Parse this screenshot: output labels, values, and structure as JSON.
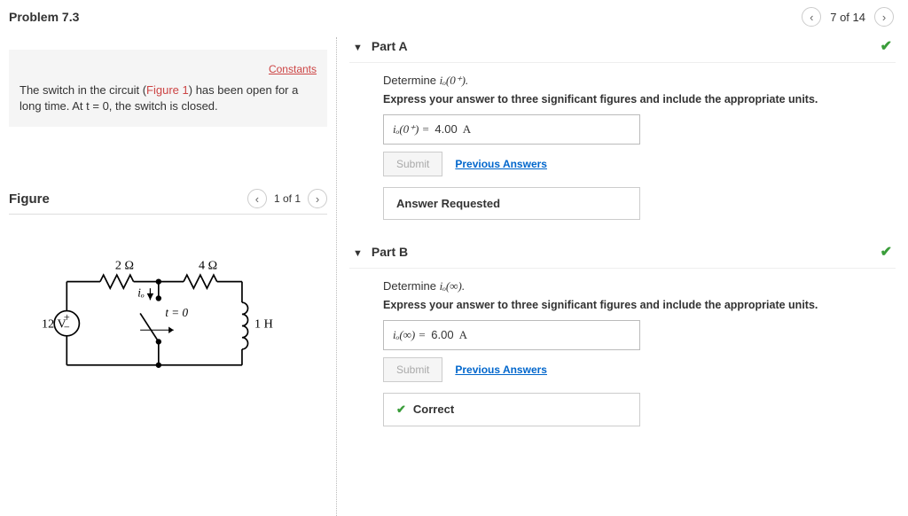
{
  "header": {
    "title": "Problem 7.3",
    "position": "7 of 14"
  },
  "left": {
    "constants_label": "Constants",
    "description_prefix": "The switch in the circuit (",
    "figure_link": "Figure 1",
    "description_suffix": ") has been open for a long time. At t = 0, the switch is closed.",
    "figure": {
      "title": "Figure",
      "position": "1 of 1"
    },
    "circuit": {
      "source": "12 V",
      "r1": "2 Ω",
      "r2": "4 Ω",
      "inductor": "1 H",
      "switch_label": "t = 0",
      "current_label": "iₒ"
    }
  },
  "parts": {
    "a": {
      "title": "Part A",
      "prompt_prefix": "Determine ",
      "prompt_var": "iₒ(0⁺).",
      "instruction": "Express your answer to three significant figures and include the appropriate units.",
      "answer_var": "iₒ(0⁺) = ",
      "answer_value": "4.00",
      "answer_unit": "A",
      "submit": "Submit",
      "prev": "Previous Answers",
      "feedback": "Answer Requested"
    },
    "b": {
      "title": "Part B",
      "prompt_prefix": "Determine ",
      "prompt_var": "iₒ(∞).",
      "instruction": "Express your answer to three significant figures and include the appropriate units.",
      "answer_var": "iₒ(∞) = ",
      "answer_value": "6.00",
      "answer_unit": "A",
      "submit": "Submit",
      "prev": "Previous Answers",
      "feedback": "Correct"
    }
  }
}
